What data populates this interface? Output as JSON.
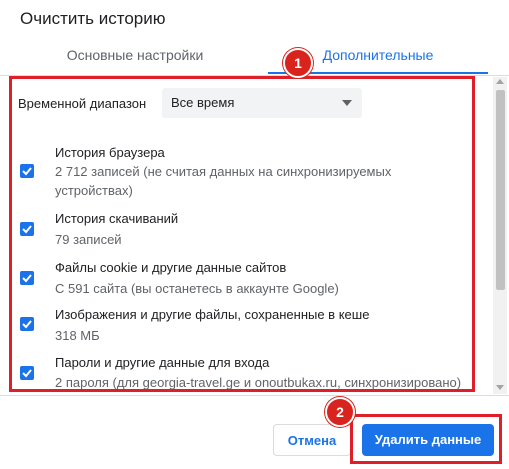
{
  "dialog": {
    "title": "Очистить историю"
  },
  "tabs": [
    {
      "label": "Основные настройки",
      "active": false
    },
    {
      "label": "Дополнительные",
      "active": true
    }
  ],
  "time_range": {
    "label": "Временной диапазон",
    "selected": "Все время"
  },
  "items": [
    {
      "title": "История браузера",
      "desc": "2 712 записей (не считая данных на синхронизируемых устройствах)",
      "checked": true
    },
    {
      "title": "История скачиваний",
      "desc": "79 записей",
      "checked": true
    },
    {
      "title": "Файлы cookie и другие данные сайтов",
      "desc": "С 591 сайта (вы останетесь в аккаунте Google)",
      "checked": true
    },
    {
      "title": "Изображения и другие файлы, сохраненные в кеше",
      "desc": "318 МБ",
      "checked": true
    },
    {
      "title": "Пароли и другие данные для входа",
      "desc": "2 пароля (для georgia-travel.ge и onoutbukax.ru, синхронизировано)",
      "checked": true
    }
  ],
  "buttons": {
    "cancel": "Отмена",
    "delete": "Удалить данные"
  },
  "annotations": {
    "badge1": "1",
    "badge2": "2"
  },
  "colors": {
    "accent": "#1a73e8",
    "annotation_red": "#e01e28"
  }
}
